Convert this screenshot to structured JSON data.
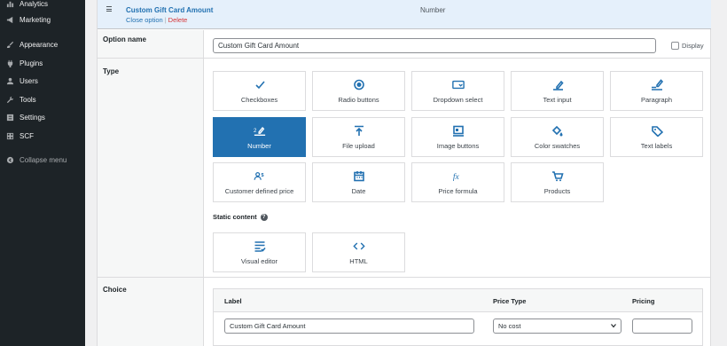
{
  "sidebar": {
    "items": [
      {
        "label": "Analytics",
        "icon": "analytics-icon"
      },
      {
        "label": "Marketing",
        "icon": "megaphone-icon"
      },
      {
        "label": "Appearance",
        "icon": "brush-icon"
      },
      {
        "label": "Plugins",
        "icon": "plug-icon"
      },
      {
        "label": "Users",
        "icon": "users-icon"
      },
      {
        "label": "Tools",
        "icon": "wrench-icon"
      },
      {
        "label": "Settings",
        "icon": "settings-icon"
      },
      {
        "label": "SCF",
        "icon": "grid-icon"
      }
    ],
    "collapse_label": "Collapse menu"
  },
  "option_header": {
    "title": "Custom Gift Card Amount",
    "close_label": "Close option",
    "separator": "|",
    "delete_label": "Delete",
    "type_label": "Number"
  },
  "option_name": {
    "row_label": "Option name",
    "value": "Custom Gift Card Amount",
    "display_label": "Display",
    "display_checked": false
  },
  "type_section": {
    "row_label": "Type",
    "tiles": [
      {
        "label": "Checkboxes",
        "icon": "checkmark-icon",
        "selected": false
      },
      {
        "label": "Radio buttons",
        "icon": "radio-icon",
        "selected": false
      },
      {
        "label": "Dropdown select",
        "icon": "dropdown-icon",
        "selected": false
      },
      {
        "label": "Text input",
        "icon": "text-input-icon",
        "selected": false
      },
      {
        "label": "Paragraph",
        "icon": "paragraph-icon",
        "selected": false
      },
      {
        "label": "Number",
        "icon": "number-icon",
        "selected": true
      },
      {
        "label": "File upload",
        "icon": "upload-icon",
        "selected": false
      },
      {
        "label": "Image buttons",
        "icon": "image-buttons-icon",
        "selected": false
      },
      {
        "label": "Color swatches",
        "icon": "paint-bucket-icon",
        "selected": false
      },
      {
        "label": "Text labels",
        "icon": "tag-icon",
        "selected": false
      },
      {
        "label": "Customer defined price",
        "icon": "customer-price-icon",
        "selected": false
      },
      {
        "label": "Date",
        "icon": "calendar-icon",
        "selected": false
      },
      {
        "label": "Price formula",
        "icon": "formula-icon",
        "selected": false
      },
      {
        "label": "Products",
        "icon": "cart-icon",
        "selected": false
      }
    ],
    "static_title": "Static content",
    "static_tiles": [
      {
        "label": "Visual editor",
        "icon": "visual-editor-icon"
      },
      {
        "label": "HTML",
        "icon": "code-icon"
      }
    ]
  },
  "choice": {
    "row_label": "Choice",
    "col_label": "Label",
    "col_price_type": "Price Type",
    "col_pricing": "Pricing",
    "row": {
      "label": "Custom Gift Card Amount",
      "price_type": "No cost",
      "pricing": ""
    }
  },
  "colors": {
    "accent": "#2271b1",
    "sidebar_bg": "#1d2327",
    "header_bg": "#e5f0fb",
    "delete": "#d63638"
  }
}
